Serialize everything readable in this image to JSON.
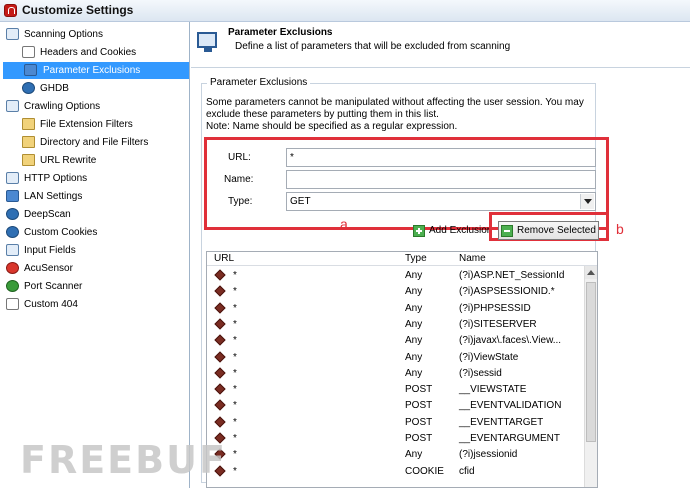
{
  "window": {
    "title": "Customize Settings"
  },
  "tree": [
    {
      "label": "Scanning Options",
      "icon": "settings-icon"
    },
    {
      "label": "Headers and Cookies",
      "icon": "document-icon"
    },
    {
      "label": "Parameter Exclusions",
      "icon": "monitor-icon"
    },
    {
      "label": "GHDB",
      "icon": "database-icon"
    },
    {
      "label": "Crawling Options",
      "icon": "crawl-icon"
    },
    {
      "label": "File Extension Filters",
      "icon": "filter-icon"
    },
    {
      "label": "Directory and File Filters",
      "icon": "filter-icon"
    },
    {
      "label": "URL Rewrite",
      "icon": "rewrite-icon"
    },
    {
      "label": "HTTP Options",
      "icon": "http-icon"
    },
    {
      "label": "LAN Settings",
      "icon": "network-icon"
    },
    {
      "label": "DeepScan",
      "icon": "deepscan-icon"
    },
    {
      "label": "Custom Cookies",
      "icon": "cookie-icon"
    },
    {
      "label": "Input Fields",
      "icon": "input-fields-icon"
    },
    {
      "label": "AcuSensor",
      "icon": "sensor-icon"
    },
    {
      "label": "Port Scanner",
      "icon": "port-scanner-icon"
    },
    {
      "label": "Custom 404",
      "icon": "document-icon"
    }
  ],
  "header": {
    "title": "Parameter Exclusions",
    "description": "Define a list of parameters that will be excluded from scanning"
  },
  "group": {
    "legend": "Parameter Exclusions",
    "intro_line1": "Some parameters cannot be manipulated without affecting the user session. You may",
    "intro_line2": "exclude these parameters by putting them in this list.",
    "intro_line3": "Note: Name should be specified as a regular expression."
  },
  "form": {
    "url_label": "URL:",
    "url_value": "*",
    "name_label": "Name:",
    "name_value": "",
    "type_label": "Type:",
    "type_value": "GET"
  },
  "annotations": {
    "a": "a",
    "b": "b"
  },
  "buttons": {
    "add": "Add Exclusion",
    "remove": "Remove Selected"
  },
  "list": {
    "columns": [
      "URL",
      "Type",
      "Name"
    ],
    "rows": [
      {
        "url": "*",
        "type": "Any",
        "name": "(?i)ASP.NET_SessionId"
      },
      {
        "url": "*",
        "type": "Any",
        "name": "(?i)ASPSESSIONID.*"
      },
      {
        "url": "*",
        "type": "Any",
        "name": "(?i)PHPSESSID"
      },
      {
        "url": "*",
        "type": "Any",
        "name": "(?i)SITESERVER"
      },
      {
        "url": "*",
        "type": "Any",
        "name": "(?i)javax\\.faces\\.View..."
      },
      {
        "url": "*",
        "type": "Any",
        "name": "(?i)ViewState"
      },
      {
        "url": "*",
        "type": "Any",
        "name": "(?i)sessid"
      },
      {
        "url": "*",
        "type": "POST",
        "name": "__VIEWSTATE"
      },
      {
        "url": "*",
        "type": "POST",
        "name": "__EVENTVALIDATION"
      },
      {
        "url": "*",
        "type": "POST",
        "name": "__EVENTTARGET"
      },
      {
        "url": "*",
        "type": "POST",
        "name": "__EVENTARGUMENT"
      },
      {
        "url": "*",
        "type": "Any",
        "name": "(?i)jsessionid"
      },
      {
        "url": "*",
        "type": "COOKIE",
        "name": "cfid"
      }
    ]
  },
  "watermark": "FREEBUF",
  "colors": {
    "selection": "#3399ff",
    "annotation": "#e0303a"
  }
}
